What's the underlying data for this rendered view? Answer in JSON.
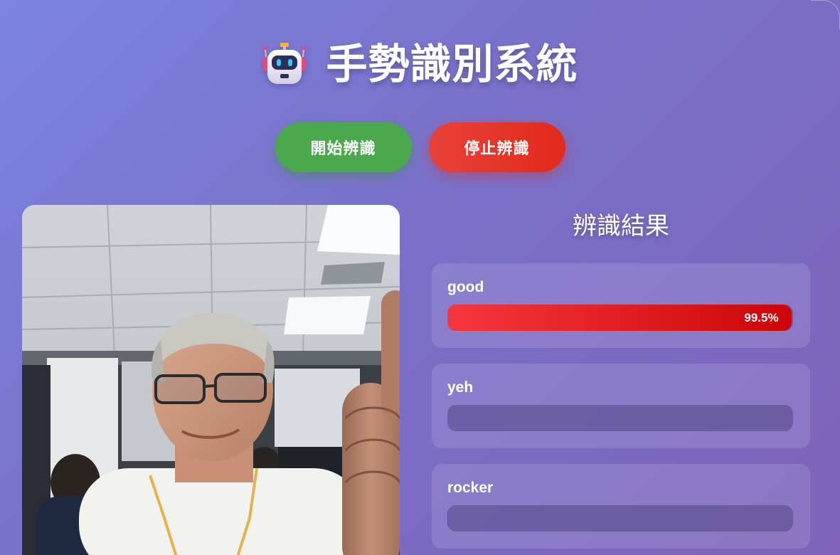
{
  "app": {
    "title": "手勢識別系統",
    "icon": "robot-icon"
  },
  "controls": {
    "start_label": "開始辨識",
    "stop_label": "停止辨識",
    "start_color": "#4ba84c",
    "stop_color": "#e12a1a"
  },
  "camera": {
    "icon": "webcam-feed"
  },
  "results": {
    "title": "辨識結果",
    "bar_color": "#d80e10",
    "items": [
      {
        "label": "good",
        "value_text": "99.5%",
        "fraction": 0.995
      },
      {
        "label": "yeh",
        "value_text": "",
        "fraction": 0.0
      },
      {
        "label": "rocker",
        "value_text": "",
        "fraction": 0.002
      }
    ]
  }
}
